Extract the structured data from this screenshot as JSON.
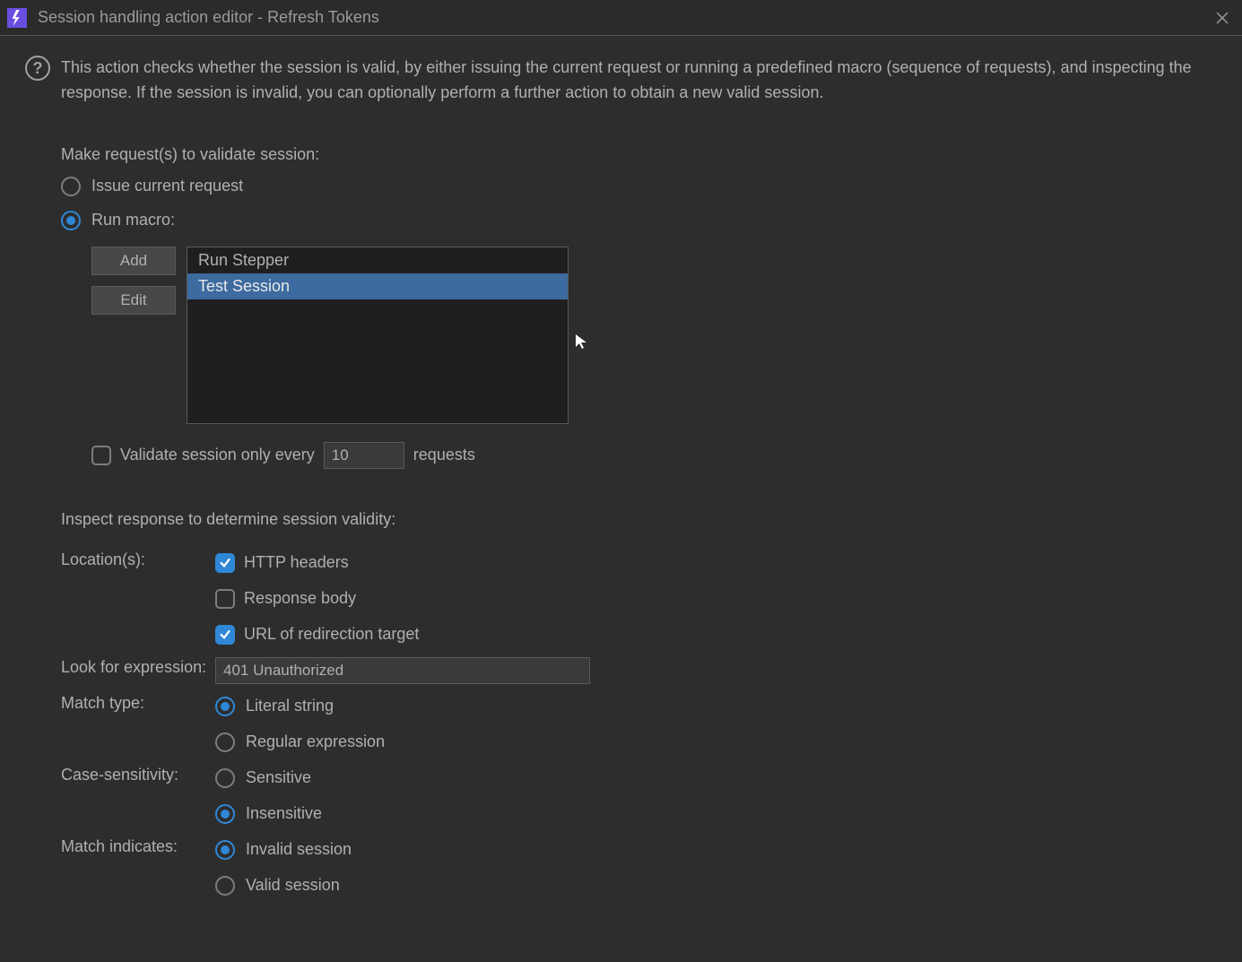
{
  "titlebar": {
    "title": "Session handling action editor - Refresh Tokens"
  },
  "description": "This action checks whether the session is valid, by either issuing the current request or running a predefined macro (sequence of requests), and inspecting the response. If the session is invalid, you can optionally perform a further action to obtain a new valid session.",
  "validate_section": {
    "heading": "Make request(s) to validate session:",
    "issue_current_label": "Issue current request",
    "run_macro_label": "Run macro:",
    "add_button": "Add",
    "edit_button": "Edit",
    "macros": [
      "Run Stepper",
      "Test Session"
    ],
    "selected_macro_index": 1,
    "validate_every_prefix": "Validate session only every",
    "validate_every_value": "10",
    "validate_every_suffix": "requests"
  },
  "inspect_section": {
    "heading": "Inspect response to determine session validity:",
    "locations_label": "Location(s):",
    "http_headers_label": "HTTP headers",
    "response_body_label": "Response body",
    "url_redirect_label": "URL of redirection target",
    "expression_label": "Look for expression:",
    "expression_value": "401 Unauthorized",
    "match_type_label": "Match type:",
    "literal_label": "Literal string",
    "regex_label": "Regular expression",
    "case_label": "Case-sensitivity:",
    "sensitive_label": "Sensitive",
    "insensitive_label": "Insensitive",
    "indicates_label": "Match indicates:",
    "invalid_label": "Invalid session",
    "valid_label": "Valid session"
  }
}
